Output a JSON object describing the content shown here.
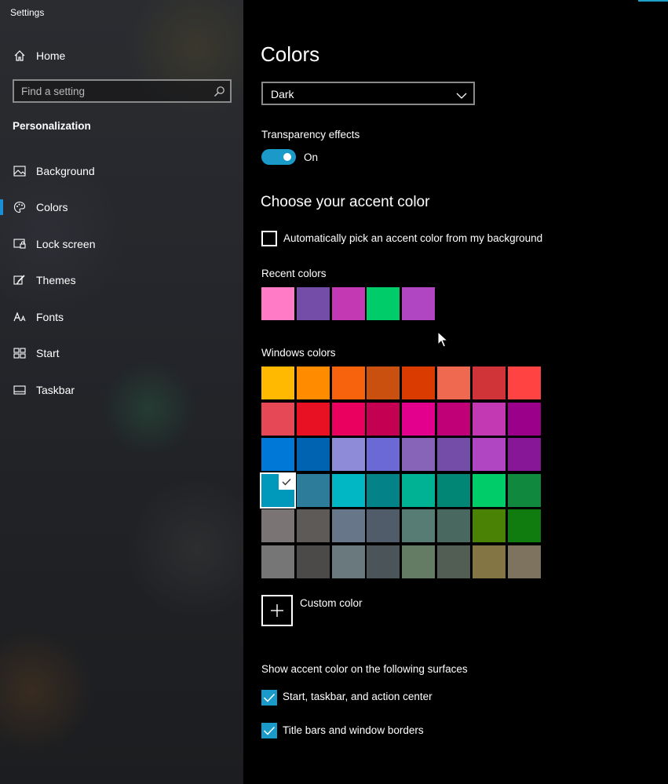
{
  "app": {
    "title": "Settings"
  },
  "sidebar": {
    "home_label": "Home",
    "search_placeholder": "Find a setting",
    "section": "Personalization",
    "items": [
      {
        "label": "Background",
        "icon": "picture-icon",
        "active": false
      },
      {
        "label": "Colors",
        "icon": "palette-icon",
        "active": true
      },
      {
        "label": "Lock screen",
        "icon": "lock-screen-icon",
        "active": false
      },
      {
        "label": "Themes",
        "icon": "brush-icon",
        "active": false
      },
      {
        "label": "Fonts",
        "icon": "font-icon",
        "active": false
      },
      {
        "label": "Start",
        "icon": "start-icon",
        "active": false
      },
      {
        "label": "Taskbar",
        "icon": "taskbar-icon",
        "active": false
      }
    ]
  },
  "main": {
    "title": "Colors",
    "mode_dropdown": {
      "value": "Dark"
    },
    "transparency": {
      "label": "Transparency effects",
      "state_label": "On",
      "on": true
    },
    "accent_heading": "Choose your accent color",
    "auto_pick": {
      "label": "Automatically pick an accent color from my background",
      "checked": false
    },
    "recent_colors": {
      "label": "Recent colors",
      "colors": [
        "#FF7BC6",
        "#744DA9",
        "#C239B3",
        "#00CC6A",
        "#B146C2"
      ]
    },
    "windows_colors": {
      "label": "Windows colors",
      "selected": "#0099BC",
      "rows": [
        [
          "#FFB900",
          "#FF8C00",
          "#F7630C",
          "#CA5010",
          "#DA3B01",
          "#EF6950",
          "#D13438",
          "#FF4343"
        ],
        [
          "#E74856",
          "#E81123",
          "#EA005E",
          "#C30052",
          "#E3008C",
          "#BF0077",
          "#C239B3",
          "#9A0089"
        ],
        [
          "#0078D7",
          "#0063B1",
          "#8E8CD8",
          "#6B69D6",
          "#8764B8",
          "#744DA9",
          "#B146C2",
          "#881798"
        ],
        [
          "#0099BC",
          "#2D7D9A",
          "#00B7C3",
          "#038387",
          "#00B294",
          "#018574",
          "#00CC6A",
          "#10893E"
        ],
        [
          "#7A7574",
          "#5D5A58",
          "#68768A",
          "#515C6B",
          "#567C73",
          "#486860",
          "#498205",
          "#107C10"
        ],
        [
          "#767676",
          "#4C4A48",
          "#69797E",
          "#4A5459",
          "#647C64",
          "#525E54",
          "#847545",
          "#7E735F"
        ]
      ]
    },
    "custom_color_label": "Custom color",
    "surfaces": {
      "label": "Show accent color on the following surfaces",
      "options": [
        {
          "label": "Start, taskbar, and action center",
          "checked": true
        },
        {
          "label": "Title bars and window borders",
          "checked": true
        }
      ]
    },
    "accent": "#1A9AC9"
  }
}
